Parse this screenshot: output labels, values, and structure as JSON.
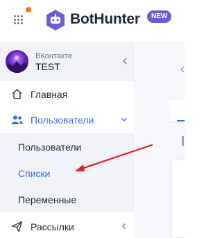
{
  "header": {
    "brand": "BotHunter",
    "badge": "NEW"
  },
  "colors": {
    "accent": "#3b6fd6",
    "badge": "#6d5dd3",
    "notification_dot": "#f97316",
    "annotation_arrow": "#e11d1d"
  },
  "icons": {
    "apps": "grid-dots-icon",
    "logo": "bot-logo-icon",
    "home": "home-icon",
    "users": "users-icon",
    "mailing": "send-icon"
  },
  "account": {
    "network": "ВКонтакте",
    "name": "TEST"
  },
  "sidebar": {
    "home": "Главная",
    "users": "Пользователи",
    "submenu": [
      "Пользователи",
      "Списки",
      "Переменные"
    ],
    "mailing": "Рассылки"
  }
}
